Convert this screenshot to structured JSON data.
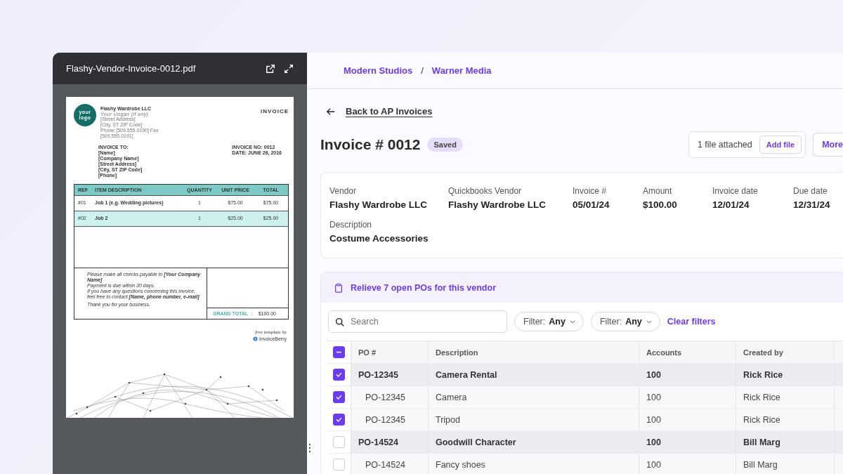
{
  "viewer": {
    "filename": "Flashy-Vendor-Invoice-0012.pdf",
    "document": {
      "logo": "your logo",
      "company": "Flashy Wardrobe LLC",
      "slogan": "Your slogan (if any)",
      "address": [
        "[Street Address]",
        "[City, ST  ZIP Code]",
        "Phone [509.555.0190]  Fax [509.555.0191]"
      ],
      "heading": "INVOICE",
      "bill_to_label": "INVOICE TO:",
      "bill_to": [
        "[Name]",
        "[Company Name]",
        "[Street Address]",
        "[City, ST  ZIP Code]",
        "[Phone]"
      ],
      "meta": [
        "INVOICE NO: 0012",
        "DATE: JUNE 26, 2016"
      ],
      "columns": [
        "REF",
        "ITEM DESCRIPTION",
        "QUANTITY",
        "UNIT PRICE",
        "TOTAL"
      ],
      "items": [
        {
          "ref": "#01",
          "title": "Job 1 (e.g. Wedding pictures)",
          "quantity": "1",
          "unit_price": "$75.00",
          "total": "$75.00",
          "highlighted": false
        },
        {
          "ref": "#02",
          "title": "Job 2",
          "quantity": "1",
          "unit_price": "$25.00",
          "total": "$25.00",
          "highlighted": true
        }
      ],
      "notes": [
        "Please make all checks payable to **[Your Company Name]**",
        "Payment is due within 30 days.",
        "If you have any questions concerning this invoice, feel free to contact **[Name, phone number, e-mail]**",
        "Thank you for your business."
      ],
      "grand_total_label": "GRAND TOTAL",
      "grand_total_separator": ":",
      "grand_total": "$100.00",
      "credit": "free template by",
      "brand": "InvoiceBerry"
    }
  },
  "breadcrumb": [
    {
      "label": "Modern Studios"
    },
    {
      "label": "Warner Media"
    }
  ],
  "breadcrumb_separator": "/",
  "back_link": "Back to AP Invoices",
  "title": "Invoice # 0012",
  "status": "Saved",
  "attachments": {
    "text": "1 file attached",
    "button": "Add file"
  },
  "more_button": "More",
  "details": [
    {
      "label": "Vendor",
      "value": "Flashy Wardrobe LLC"
    },
    {
      "label": "Quickbooks Vendor",
      "value": "Flashy Wardrobe LLC"
    },
    {
      "label": "Invoice #",
      "value": "05/01/24"
    },
    {
      "label": "Amount",
      "value": "$100.00"
    },
    {
      "label": "Invoice date",
      "value": "12/01/24"
    },
    {
      "label": "Due date",
      "value": "12/31/24"
    },
    {
      "label": "Description",
      "value": "Costume Accessories"
    }
  ],
  "po_panel": {
    "banner": "Relieve 7 open POs for this vendor",
    "search": {
      "placeholder": "Search"
    },
    "filters": [
      {
        "label": "Filter:",
        "value": "Any"
      },
      {
        "label": "Filter:",
        "value": "Any"
      }
    ],
    "clear_filters": "Clear filters",
    "select_all": {
      "checked": true,
      "partial": true
    },
    "columns": [
      "PO #",
      "Description",
      "Accounts",
      "Created by"
    ],
    "rows": [
      {
        "kind": "group",
        "checked": true,
        "po": "PO-12345",
        "description": "Camera Rental",
        "accounts": "100",
        "created_by": "Rick Rice"
      },
      {
        "kind": "item",
        "checked": true,
        "po": "PO-12345",
        "description": "Camera",
        "accounts": "100",
        "created_by": "Rick Rice"
      },
      {
        "kind": "item",
        "checked": true,
        "po": "PO-12345",
        "description": "Tripod",
        "accounts": "100",
        "created_by": "Rick Rice"
      },
      {
        "kind": "group",
        "checked": false,
        "po": "PO-14524",
        "description": "Goodwill Character",
        "accounts": "100",
        "created_by": "Bill Marg"
      },
      {
        "kind": "item",
        "checked": false,
        "po": "PO-14524",
        "description": "Fancy shoes",
        "accounts": "100",
        "created_by": "Bill Marg"
      }
    ]
  }
}
